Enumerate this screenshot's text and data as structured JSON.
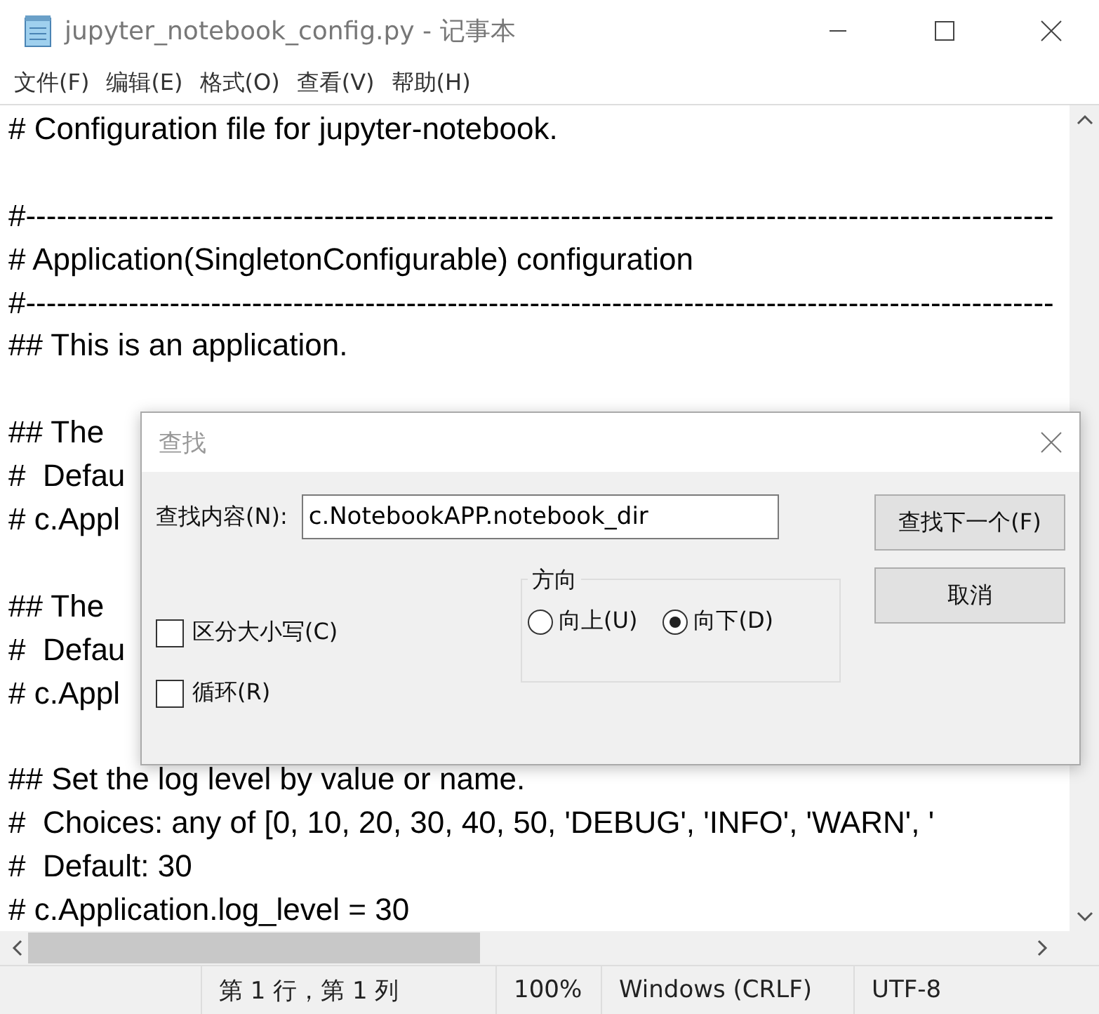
{
  "window": {
    "title": "jupyter_notebook_config.py - 记事本"
  },
  "menu": [
    "文件(F)",
    "编辑(E)",
    "格式(O)",
    "查看(V)",
    "帮助(H)"
  ],
  "editor": {
    "lines": [
      {
        "kind": "text",
        "text": "# Configuration file for jupyter-notebook."
      },
      {
        "kind": "blank"
      },
      {
        "kind": "text",
        "text": "#----------------------------------------------------------------------------------------------------"
      },
      {
        "kind": "text",
        "text": "# Application(SingletonConfigurable) configuration"
      },
      {
        "kind": "text",
        "text": "#----------------------------------------------------------------------------------------------------"
      },
      {
        "kind": "text",
        "text": "## This is an application."
      },
      {
        "kind": "blank"
      },
      {
        "kind": "text",
        "text": "## The"
      },
      {
        "kind": "text",
        "text": "#  Defau"
      },
      {
        "kind": "text",
        "text": "# c.Appl"
      },
      {
        "kind": "blank"
      },
      {
        "kind": "text",
        "text": "## The"
      },
      {
        "kind": "text",
        "text": "#  Defau"
      },
      {
        "kind": "text",
        "text": "# c.Appl"
      },
      {
        "kind": "blank"
      },
      {
        "kind": "text",
        "text": "## Set the log level by value or name."
      },
      {
        "kind": "text",
        "text": "#  Choices: any of [0, 10, 20, 30, 40, 50, 'DEBUG', 'INFO', 'WARN', '"
      },
      {
        "kind": "text",
        "text": "#  Default: 30"
      },
      {
        "kind": "text",
        "text": "# c.Application.log_level = 30"
      }
    ]
  },
  "find_dialog": {
    "title": "查找",
    "find_label": "查找内容(N):",
    "find_value": "c.NotebookAPP.notebook_dir",
    "buttons": [
      "查找下一个(F)",
      "取消"
    ],
    "direction": {
      "label": "方向",
      "options": [
        {
          "label": "向上(U)",
          "selected": false
        },
        {
          "label": "向下(D)",
          "selected": true
        }
      ]
    },
    "checkboxes": [
      {
        "label": "区分大小写(C)",
        "checked": false
      },
      {
        "label": "循环(R)",
        "checked": false
      }
    ]
  },
  "status_bar": [
    "第 1 行，第 1 列",
    "100%",
    "Windows (CRLF)",
    "UTF-8"
  ]
}
